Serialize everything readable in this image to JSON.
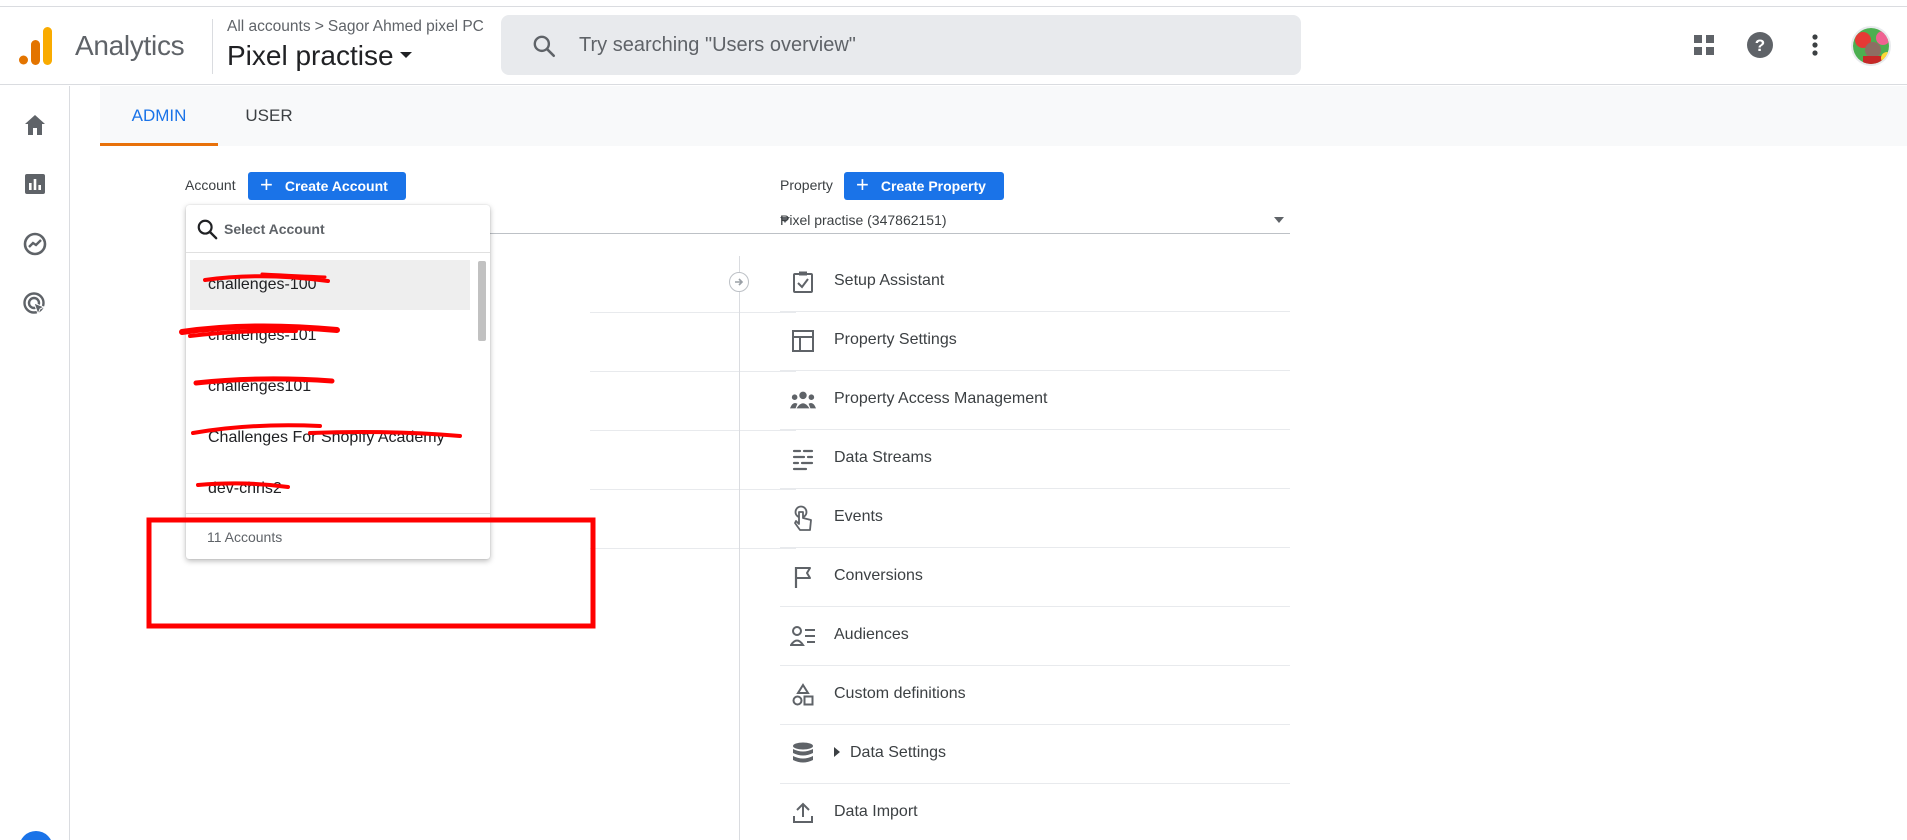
{
  "header": {
    "app_name": "Analytics",
    "breadcrumb_root": "All accounts",
    "breadcrumb_separator": ">",
    "breadcrumb_account": "Sagor Ahmed pixel PC",
    "property_name": "Pixel practise",
    "search_placeholder": "Try searching \"Users overview\""
  },
  "left_nav": {
    "items": [
      "home-icon",
      "reports-icon",
      "explore-icon",
      "advertising-icon"
    ]
  },
  "tabs": {
    "admin": "ADMIN",
    "user": "USER",
    "active": "ADMIN"
  },
  "account_column": {
    "label": "Account",
    "create_button": "Create Account"
  },
  "property_column": {
    "label": "Property",
    "create_button": "Create Property",
    "selected": "Pixel practise (347862151)",
    "items": [
      {
        "label": "Setup Assistant",
        "icon": "checklist-icon"
      },
      {
        "label": "Property Settings",
        "icon": "layout-icon"
      },
      {
        "label": "Property Access Management",
        "icon": "people-icon"
      },
      {
        "label": "Data Streams",
        "icon": "streams-icon"
      },
      {
        "label": "Events",
        "icon": "touch-icon"
      },
      {
        "label": "Conversions",
        "icon": "flag-icon"
      },
      {
        "label": "Audiences",
        "icon": "audience-icon"
      },
      {
        "label": "Custom definitions",
        "icon": "shapes-icon"
      },
      {
        "label": "Data Settings",
        "icon": "database-icon"
      },
      {
        "label": "Data Import",
        "icon": "upload-icon"
      }
    ]
  },
  "account_dropdown": {
    "search_placeholder": "Select Account",
    "items": [
      "challenges-100",
      "challenges-101",
      "challenges101",
      "Challenges For Shopify Academy",
      "dev-chris2"
    ],
    "footer": "11 Accounts"
  },
  "colors": {
    "accent_blue": "#1a73e8",
    "tab_underline": "#e8710a",
    "annotation_red": "#ff0000"
  }
}
